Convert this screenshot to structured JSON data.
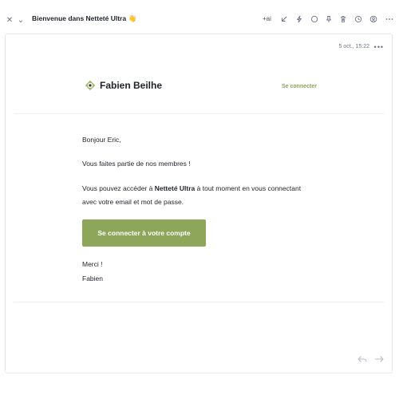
{
  "toolbar": {
    "subject": "Bienvenue dans Netteté Ultra 👋",
    "ai_label": "+ai",
    "icons": [
      "close-icon",
      "chevron-down-icon",
      "reply-arrow-icon",
      "bolt-icon",
      "circle-icon",
      "pin-icon",
      "trash-icon",
      "clock-icon",
      "contact-icon",
      "more-icon"
    ]
  },
  "message": {
    "date": "5 oct., 15:22",
    "more": "•••",
    "brand_name": "Fabien Beilhe",
    "login_link": "Se connecter",
    "greeting": "Bonjour Eric,",
    "line_member": "Vous faites partie de nos membres !",
    "access_before": "Vous pouvez accéder à ",
    "access_product": "Netteté Ultra",
    "access_after": " à tout moment en vous connectant",
    "access_line2": "avec votre email et mot de passe.",
    "cta_label": "Se connecter à votre compte",
    "thanks": "Merci !",
    "signature": "Fabien"
  },
  "colors": {
    "accent": "#8da65a",
    "link": "#8aa35a",
    "logo": "#9fb86a"
  }
}
